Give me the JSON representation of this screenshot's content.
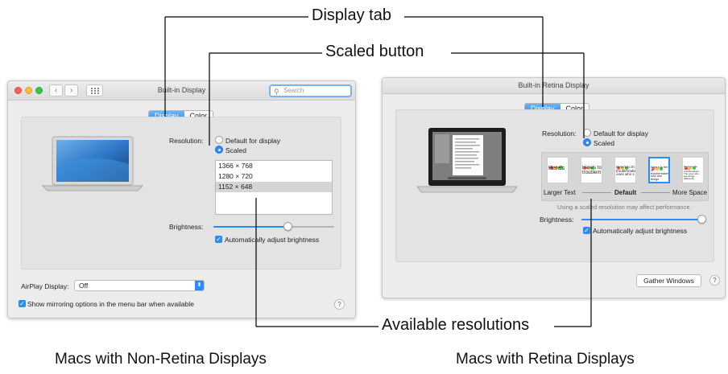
{
  "callouts": {
    "display_tab": "Display tab",
    "scaled_button": "Scaled button",
    "available_resolutions": "Available resolutions"
  },
  "captions": {
    "left": "Macs with Non-Retina Displays",
    "right": "Macs with Retina Displays"
  },
  "left_window": {
    "title": "Built-in Display",
    "search_placeholder": "Search",
    "tabs": [
      "Display",
      "Color"
    ],
    "active_tab": "Display",
    "resolution_label": "Resolution:",
    "option_default": "Default for display",
    "option_scaled": "Scaled",
    "resolutions": [
      "1366 × 768",
      "1280 × 720",
      "1152 × 648"
    ],
    "selected_resolution": "1152 × 648",
    "brightness_label": "Brightness:",
    "brightness_level": 0.62,
    "auto_brightness": "Automatically adjust brightness",
    "airplay_label": "AirPlay Display:",
    "airplay_value": "Off",
    "mirroring_label": "Show mirroring options in the menu bar when available",
    "help": "?"
  },
  "right_window": {
    "title": "Built-in Retina Display",
    "tabs": [
      "Display",
      "Color"
    ],
    "active_tab": "Display",
    "resolution_label": "Resolution:",
    "option_default": "Default for display",
    "option_scaled": "Scaled",
    "scale_options": [
      "Here's",
      "Here's to troublem",
      "Here's to th troublemake ones who s",
      "Here's to the cr troublemakers. who see things",
      "Here's to the crazy troublemakers. The ones who see things differently"
    ],
    "selected_scale_index": 3,
    "larger_text": "Larger Text",
    "default_label": "Default",
    "more_space": "More Space",
    "note": "Using a scaled resolution may affect performance.",
    "brightness_label": "Brightness:",
    "brightness_level": 1.0,
    "auto_brightness": "Automatically adjust brightness",
    "gather_windows": "Gather Windows",
    "help": "?"
  },
  "colors": {
    "accent": "#2c8cf5",
    "window_bg": "#ececec",
    "panel_bg": "#e3e3e3"
  }
}
